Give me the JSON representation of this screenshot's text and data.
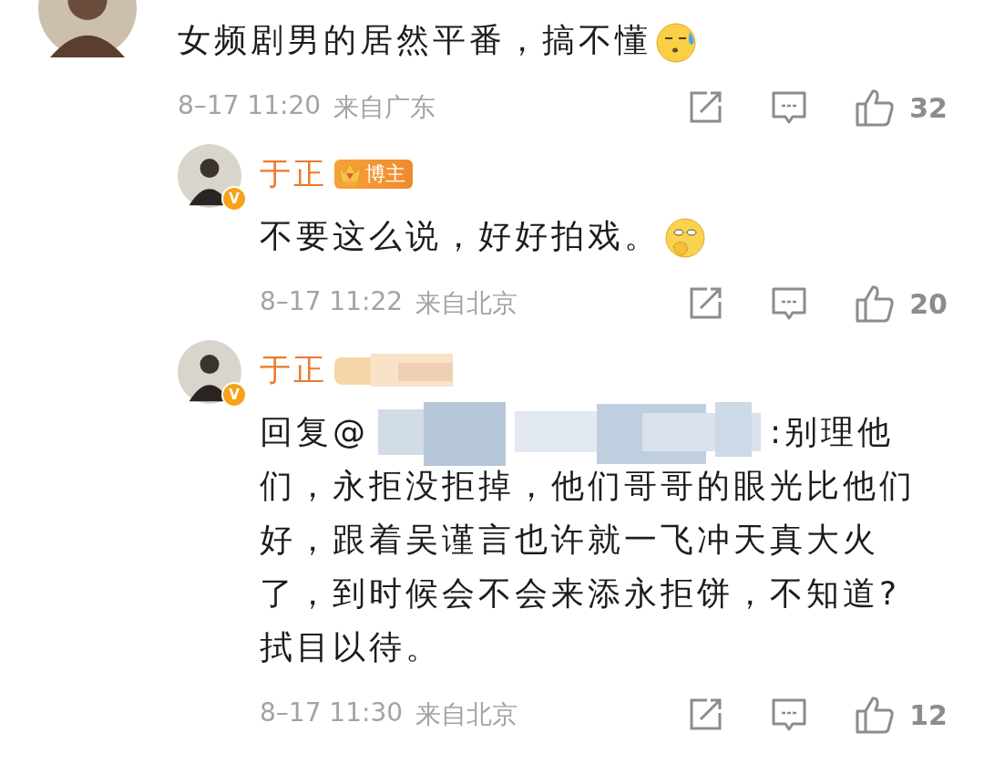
{
  "comment": {
    "text": [
      {
        "kind": "text",
        "text": "女频剧男的居然平番，搞不懂"
      },
      {
        "kind": "sweat"
      }
    ],
    "time": "8–17 11:20",
    "location": "来自广东",
    "likes": "32",
    "replies": [
      {
        "author": "于正",
        "verified": "V",
        "badge": {
          "kind": "label",
          "label": "博主"
        },
        "text": [
          {
            "kind": "text",
            "text": "不要这么说，好好拍戏。"
          },
          {
            "kind": "cover"
          }
        ],
        "time": "8–17 11:22",
        "location": "来自北京",
        "likes": "20"
      },
      {
        "author": "于正",
        "verified": "V",
        "badge": {
          "kind": "redaction"
        },
        "text": [
          {
            "kind": "text",
            "text": "回复@"
          },
          {
            "kind": "redaction"
          },
          {
            "kind": "text",
            "text": ":别理他"
          },
          {
            "kind": "line",
            "text": "们，永拒没拒掉，他们哥哥的眼光比他们"
          },
          {
            "kind": "line",
            "text": "好，跟着吴谨言也许就一飞冲天真大火"
          },
          {
            "kind": "line",
            "text": "了，到时候会不会来添永拒饼，不知道?"
          },
          {
            "kind": "line",
            "text": "拭目以待。"
          }
        ],
        "time": "8–17 11:30",
        "location": "来自北京",
        "likes": "12"
      }
    ]
  }
}
